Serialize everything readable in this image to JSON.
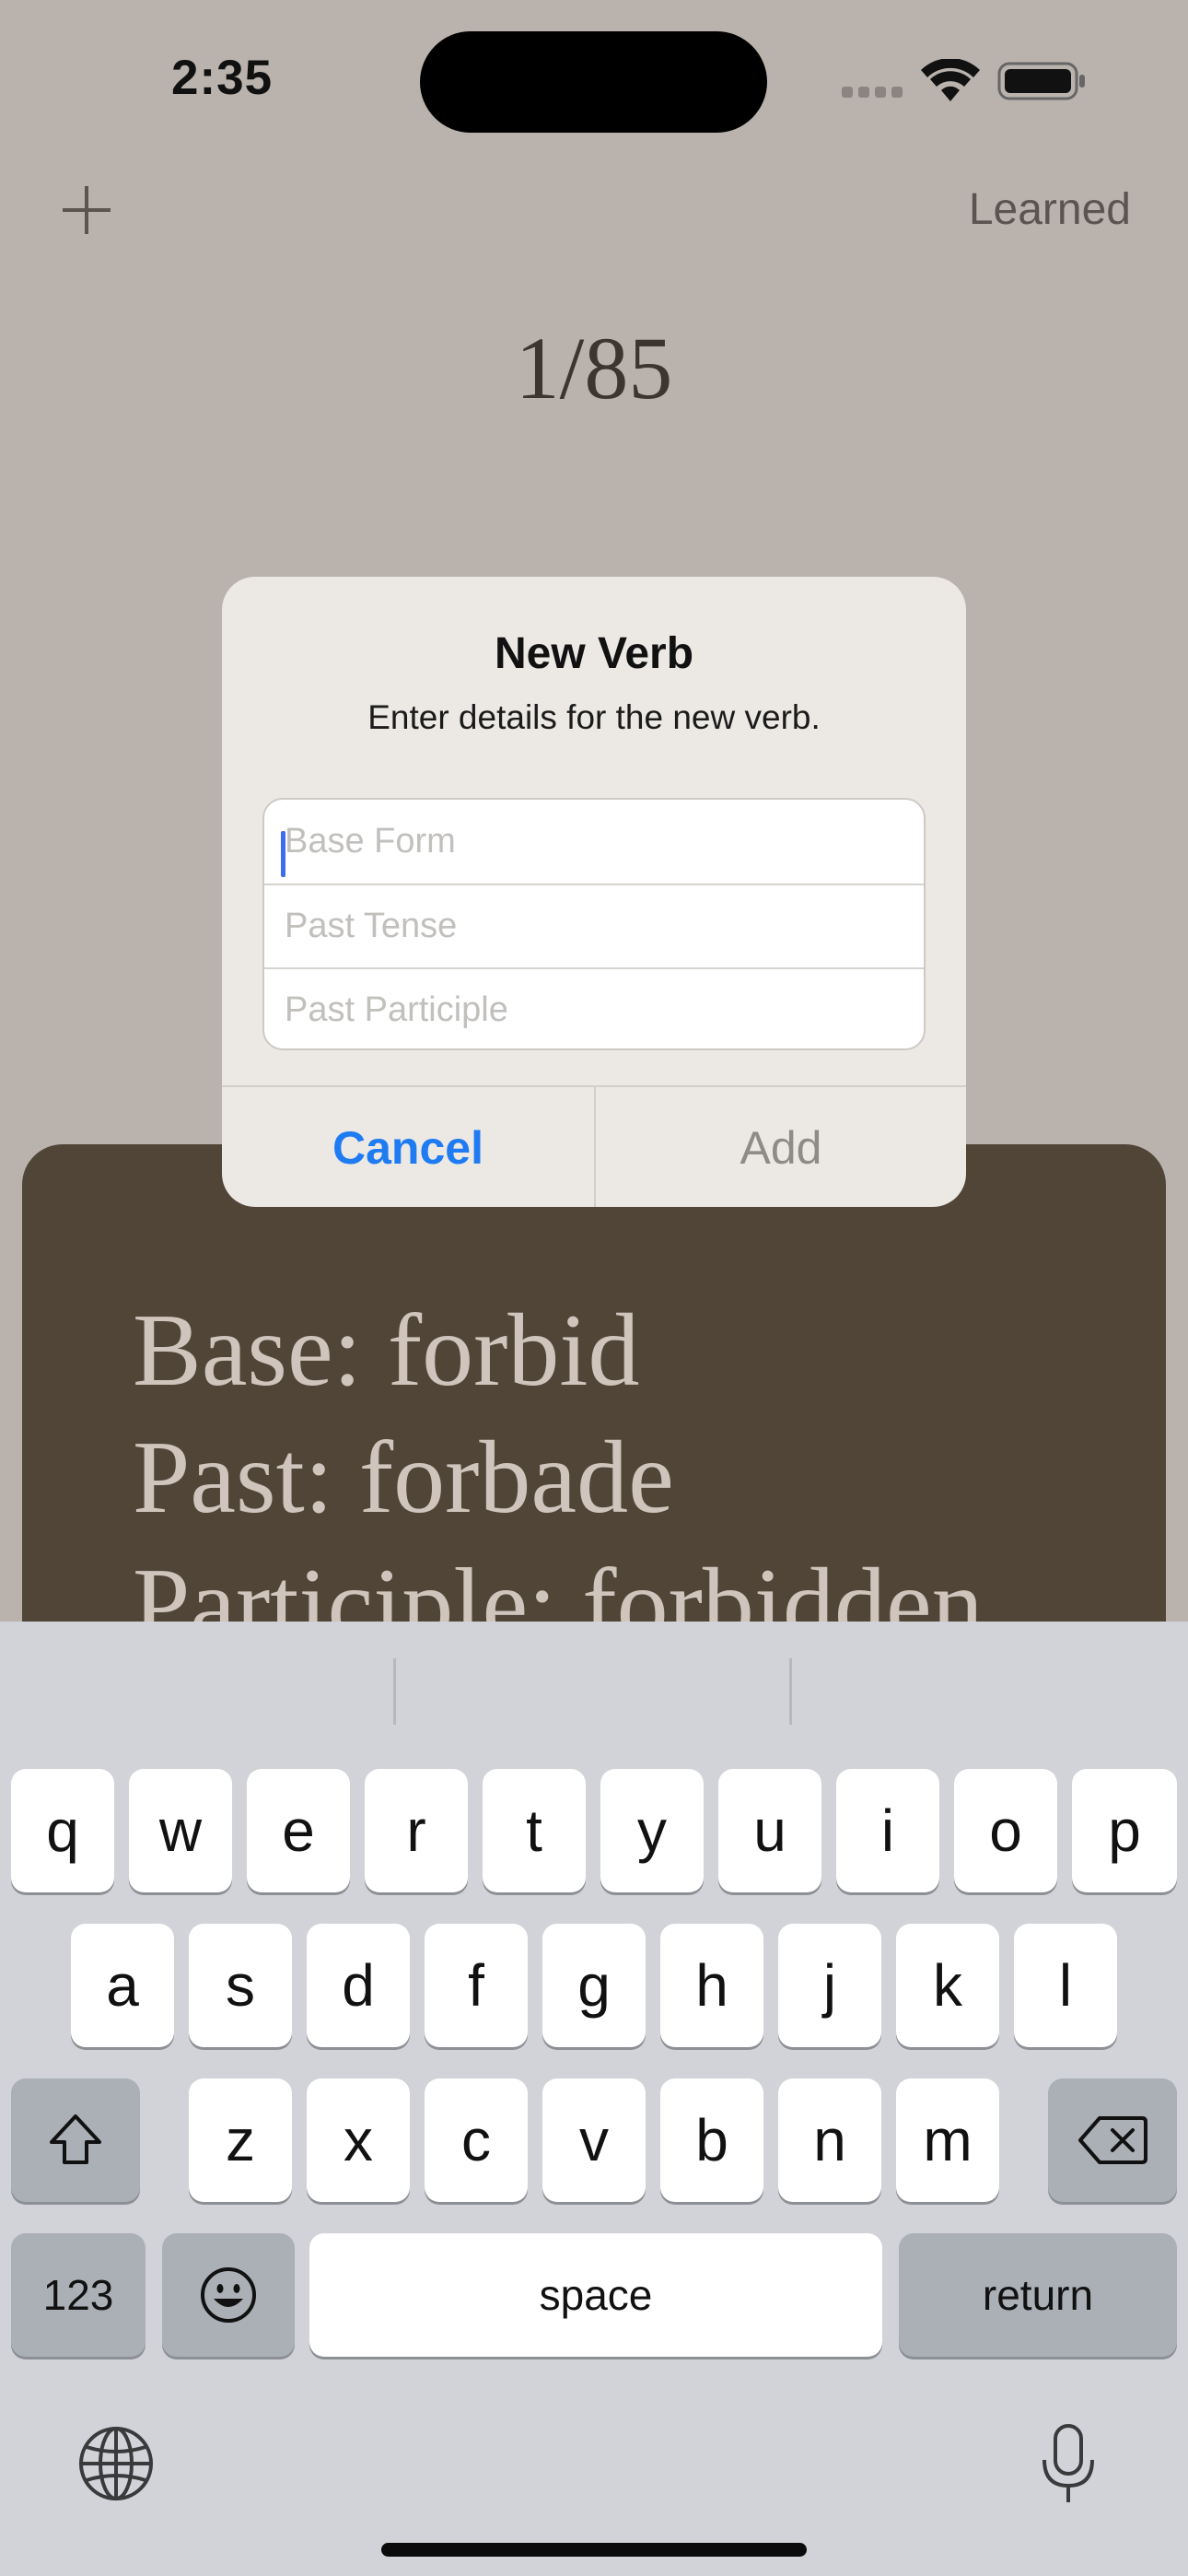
{
  "status_bar": {
    "time": "2:35"
  },
  "nav": {
    "add_icon": "plus-icon",
    "learned_label": "Learned"
  },
  "counter": "1/85",
  "card": {
    "base": "Base: forbid",
    "past": "Past: forbade",
    "participle": "Participle: forbidden"
  },
  "alert": {
    "title": "New Verb",
    "message": "Enter details for the new verb.",
    "fields": [
      {
        "placeholder": "Base Form",
        "value": ""
      },
      {
        "placeholder": "Past Tense",
        "value": ""
      },
      {
        "placeholder": "Past Participle",
        "value": ""
      }
    ],
    "cancel_label": "Cancel",
    "add_label": "Add",
    "colors": {
      "cancel": "#1f7bf2",
      "add_disabled": "#8e8b88"
    }
  },
  "keyboard": {
    "row1": [
      "q",
      "w",
      "e",
      "r",
      "t",
      "y",
      "u",
      "i",
      "o",
      "p"
    ],
    "row2": [
      "a",
      "s",
      "d",
      "f",
      "g",
      "h",
      "j",
      "k",
      "l"
    ],
    "row3": [
      "z",
      "x",
      "c",
      "v",
      "b",
      "n",
      "m"
    ],
    "numbers_label": "123",
    "space_label": "space",
    "return_label": "return",
    "icons": [
      "shift-icon",
      "delete-icon",
      "emoji-icon",
      "globe-icon",
      "mic-icon"
    ]
  },
  "colors": {
    "background": "#bab3ad",
    "card": "#514538",
    "card_text": "#cfc5bc",
    "keyboard": "#d1d3d8"
  }
}
